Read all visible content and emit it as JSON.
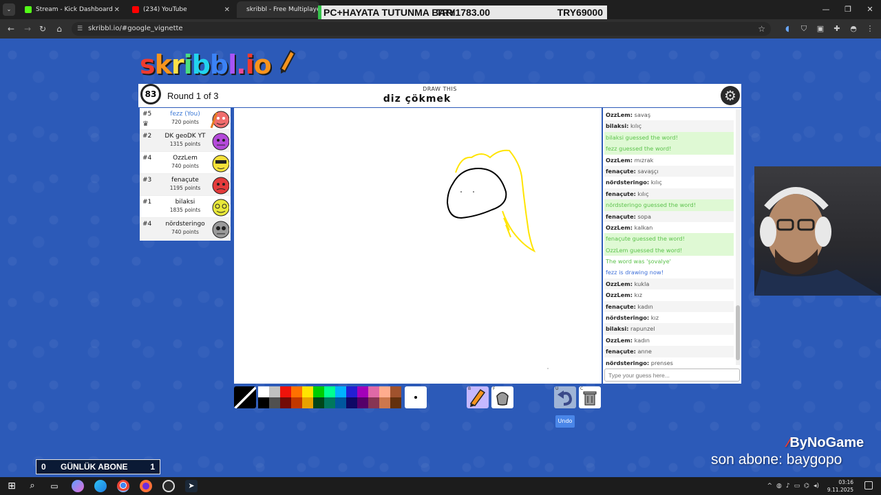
{
  "browser": {
    "tabs": [
      {
        "label": "Stream - Kick Dashboard",
        "color": "#53fc18"
      },
      {
        "label": "(234) YouTube",
        "color": "#ff0000"
      },
      {
        "label": "skribbl - Free Multiplayer D",
        "color": "#8a8aff"
      }
    ],
    "url": "skribbl.io/#google_vignette"
  },
  "ticker": {
    "text": "PC+HAYATA TUTUNMA BARI",
    "overlap_text": "TRY1783.00",
    "right_text": "TRY69000"
  },
  "logo": {
    "letters": [
      "s",
      "k",
      "r",
      "i",
      "b",
      "b",
      "l",
      ".",
      "i",
      "o"
    ],
    "colors": [
      "#ef3b2e",
      "#f7941d",
      "#fde047",
      "#4ade80",
      "#22d3ee",
      "#3b82f6",
      "#a855f7",
      "#ec4899",
      "#ef3b2e",
      "#f7941d"
    ]
  },
  "game": {
    "timer": "83",
    "round": "Round 1 of 3",
    "draw_this": "DRAW THIS",
    "word": "diz çökmek"
  },
  "players": [
    {
      "rank": "#5",
      "name": "fezz (You)",
      "points": "720 points",
      "you": true,
      "avatar_color": "#f06d6d"
    },
    {
      "rank": "#2",
      "name": "DK geoDK YT",
      "points": "1315 points",
      "you": false,
      "avatar_color": "#b44ad9"
    },
    {
      "rank": "#4",
      "name": "OzzLem",
      "points": "740 points",
      "you": false,
      "avatar_color": "#f5e13a"
    },
    {
      "rank": "#3",
      "name": "fenaçute",
      "points": "1195 points",
      "you": false,
      "avatar_color": "#e33b3b"
    },
    {
      "rank": "#1",
      "name": "bilaksi",
      "points": "1835 points",
      "you": false,
      "avatar_color": "#e8e83a"
    },
    {
      "rank": "#4",
      "name": "nördsteringo",
      "points": "740 points",
      "you": false,
      "avatar_color": "#9a9a9a"
    }
  ],
  "chat": [
    {
      "type": "msg",
      "who": "OzzLem:",
      "text": " savaş"
    },
    {
      "type": "msg",
      "who": "bilaksi:",
      "text": " kılıç"
    },
    {
      "type": "guess",
      "who": "",
      "text": "bilaksi guessed the word!"
    },
    {
      "type": "guess",
      "who": "",
      "text": "fezz guessed the word!"
    },
    {
      "type": "msg",
      "who": "OzzLem:",
      "text": " mızrak"
    },
    {
      "type": "msg",
      "who": "fenaçute:",
      "text": " savaşçı"
    },
    {
      "type": "msg",
      "who": "nördsteringo:",
      "text": " kılıç"
    },
    {
      "type": "msg",
      "who": "fenaçute:",
      "text": " kılıç"
    },
    {
      "type": "guess",
      "who": "",
      "text": "nördsteringo guessed the word!"
    },
    {
      "type": "msg",
      "who": "fenaçute:",
      "text": " sopa"
    },
    {
      "type": "msg",
      "who": "OzzLem:",
      "text": " kalkan"
    },
    {
      "type": "guess",
      "who": "",
      "text": "fenaçute guessed the word!"
    },
    {
      "type": "guess",
      "who": "",
      "text": "OzzLem guessed the word!"
    },
    {
      "type": "sys",
      "who": "",
      "text": "The word was 'şovalye'"
    },
    {
      "type": "draw",
      "who": "",
      "text": "fezz is drawing now!"
    },
    {
      "type": "msg",
      "who": "OzzLem:",
      "text": " kukla"
    },
    {
      "type": "msg",
      "who": "OzzLem:",
      "text": " kız"
    },
    {
      "type": "msg",
      "who": "fenaçute:",
      "text": " kadın"
    },
    {
      "type": "msg",
      "who": "nördsteringo:",
      "text": " kız"
    },
    {
      "type": "msg",
      "who": "bilaksi:",
      "text": " rapunzel"
    },
    {
      "type": "msg",
      "who": "OzzLem:",
      "text": " kadın"
    },
    {
      "type": "msg",
      "who": "fenaçute:",
      "text": " anne"
    },
    {
      "type": "msg",
      "who": "nördsteringo:",
      "text": " prenses"
    }
  ],
  "guess_placeholder": "Type your guess here...",
  "palette": {
    "top": [
      "#ffffff",
      "#c1c1c1",
      "#ef130b",
      "#ff7100",
      "#ffe400",
      "#00cc00",
      "#00ff91",
      "#00b2ff",
      "#231fd3",
      "#a300ba",
      "#df69a7",
      "#ffac8e",
      "#a0522d"
    ],
    "bottom": [
      "#000000",
      "#505050",
      "#740b07",
      "#c23800",
      "#e8a200",
      "#004619",
      "#00785d",
      "#00569e",
      "#0e0865",
      "#550069",
      "#873554",
      "#cc774d",
      "#63300d"
    ]
  },
  "tools": {
    "undo_label": "Undo",
    "pen_key": "B",
    "fill_key": "F",
    "undo_key": "U",
    "clear_key": "C"
  },
  "overlays": {
    "abone_left": "0",
    "abone_label": "GÜNLÜK ABONE",
    "abone_right": "1",
    "brand": "ByNoGame",
    "son_abone": "son abone: baygopo"
  },
  "taskbar": {
    "time": "03:16",
    "date": "9.11.2025"
  }
}
